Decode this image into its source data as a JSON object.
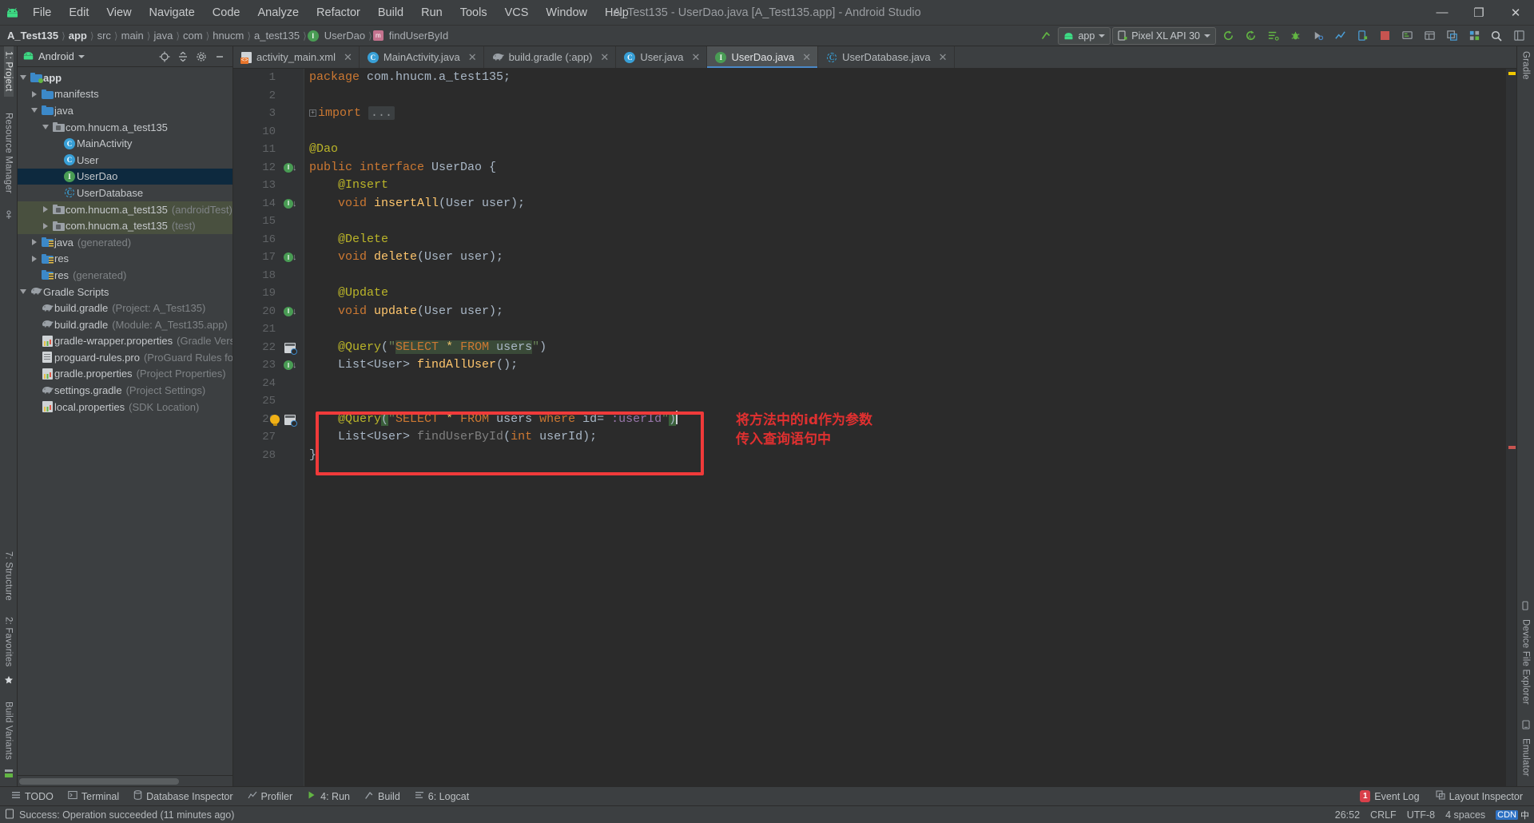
{
  "window": {
    "title": "A_Test135 - UserDao.java [A_Test135.app] - Android Studio",
    "minimize": "—",
    "maximize": "❐",
    "close": "✕"
  },
  "menu": [
    "File",
    "Edit",
    "View",
    "Navigate",
    "Code",
    "Analyze",
    "Refactor",
    "Build",
    "Run",
    "Tools",
    "VCS",
    "Window",
    "Help"
  ],
  "breadcrumb": [
    {
      "label": "A_Test135",
      "bold": true,
      "icon": ""
    },
    {
      "label": "app",
      "bold": true,
      "icon": ""
    },
    {
      "label": "src",
      "bold": false,
      "icon": ""
    },
    {
      "label": "main",
      "bold": false,
      "icon": ""
    },
    {
      "label": "java",
      "bold": false,
      "icon": ""
    },
    {
      "label": "com",
      "bold": false,
      "icon": ""
    },
    {
      "label": "hnucm",
      "bold": false,
      "icon": ""
    },
    {
      "label": "a_test135",
      "bold": false,
      "icon": ""
    },
    {
      "label": "UserDao",
      "bold": false,
      "icon": "interface-icon"
    },
    {
      "label": "findUserById",
      "bold": false,
      "icon": "method-icon"
    }
  ],
  "toolbar": {
    "build_icon": "hammer-icon",
    "run_config": "app",
    "device": "Pixel XL API 30",
    "icons": [
      "sync-gradle-icon",
      "avd-manager-icon",
      "layout-editor-icon",
      "debug-icon",
      "profiler-icon",
      "attach-debugger-icon",
      "stop-icon",
      "device-manager-icon",
      "layout-inspector-icon",
      "sdk-manager-icon",
      "search-everywhere-icon",
      "project-structure-icon"
    ]
  },
  "left_rail": {
    "top": [
      "1: Project"
    ],
    "middle": [
      "Resource Manager"
    ],
    "bottom": [
      "7: Structure",
      "2: Favorites",
      "Build Variants"
    ]
  },
  "right_rail": {
    "items": [
      "Gradle",
      "Device File Explorer",
      "Emulator"
    ]
  },
  "project_panel": {
    "title": "Android",
    "header_icons": [
      "locate-icon",
      "collapse-all-icon",
      "settings-icon",
      "hide-icon"
    ],
    "tree": [
      {
        "depth": 0,
        "twisty": "down",
        "icon": "module-folder-icon",
        "label": "app",
        "bold": true,
        "sub": "",
        "state": "normal"
      },
      {
        "depth": 1,
        "twisty": "right",
        "icon": "folder-icon",
        "label": "manifests",
        "bold": false,
        "sub": "",
        "state": "normal"
      },
      {
        "depth": 1,
        "twisty": "down",
        "icon": "folder-icon",
        "label": "java",
        "bold": false,
        "sub": "",
        "state": "normal"
      },
      {
        "depth": 2,
        "twisty": "down",
        "icon": "package-icon",
        "label": "com.hnucm.a_test135",
        "bold": false,
        "sub": "",
        "state": "normal"
      },
      {
        "depth": 3,
        "twisty": "none",
        "icon": "class-icon",
        "label": "MainActivity",
        "bold": false,
        "sub": "",
        "state": "normal"
      },
      {
        "depth": 3,
        "twisty": "none",
        "icon": "class-icon",
        "label": "User",
        "bold": false,
        "sub": "",
        "state": "normal"
      },
      {
        "depth": 3,
        "twisty": "none",
        "icon": "interface-icon",
        "label": "UserDao",
        "bold": false,
        "sub": "",
        "state": "selected"
      },
      {
        "depth": 3,
        "twisty": "none",
        "icon": "abstract-class-icon",
        "label": "UserDatabase",
        "bold": false,
        "sub": "",
        "state": "normal"
      },
      {
        "depth": 2,
        "twisty": "right",
        "icon": "package-icon",
        "label": "com.hnucm.a_test135",
        "bold": false,
        "sub": "(androidTest)",
        "state": "test"
      },
      {
        "depth": 2,
        "twisty": "right",
        "icon": "package-icon",
        "label": "com.hnucm.a_test135",
        "bold": false,
        "sub": "(test)",
        "state": "test"
      },
      {
        "depth": 1,
        "twisty": "right",
        "icon": "generated-folder-icon",
        "label": "java",
        "bold": false,
        "sub": "(generated)",
        "state": "normal"
      },
      {
        "depth": 1,
        "twisty": "right",
        "icon": "res-folder-icon",
        "label": "res",
        "bold": false,
        "sub": "",
        "state": "normal"
      },
      {
        "depth": 1,
        "twisty": "none",
        "icon": "res-folder-icon",
        "label": "res",
        "bold": false,
        "sub": "(generated)",
        "state": "normal"
      },
      {
        "depth": 0,
        "twisty": "down",
        "icon": "gradle-icon",
        "label": "Gradle Scripts",
        "bold": false,
        "sub": "",
        "state": "normal"
      },
      {
        "depth": 1,
        "twisty": "none",
        "icon": "gradle-icon",
        "label": "build.gradle",
        "bold": false,
        "sub": "(Project: A_Test135)",
        "state": "normal"
      },
      {
        "depth": 1,
        "twisty": "none",
        "icon": "gradle-icon",
        "label": "build.gradle",
        "bold": false,
        "sub": "(Module: A_Test135.app)",
        "state": "normal"
      },
      {
        "depth": 1,
        "twisty": "none",
        "icon": "properties-icon",
        "label": "gradle-wrapper.properties",
        "bold": false,
        "sub": "(Gradle Version)",
        "state": "normal"
      },
      {
        "depth": 1,
        "twisty": "none",
        "icon": "document-icon",
        "label": "proguard-rules.pro",
        "bold": false,
        "sub": "(ProGuard Rules for A_T",
        "state": "normal"
      },
      {
        "depth": 1,
        "twisty": "none",
        "icon": "properties-icon",
        "label": "gradle.properties",
        "bold": false,
        "sub": "(Project Properties)",
        "state": "normal"
      },
      {
        "depth": 1,
        "twisty": "none",
        "icon": "gradle-icon",
        "label": "settings.gradle",
        "bold": false,
        "sub": "(Project Settings)",
        "state": "normal"
      },
      {
        "depth": 1,
        "twisty": "none",
        "icon": "properties-icon",
        "label": "local.properties",
        "bold": false,
        "sub": "(SDK Location)",
        "state": "normal"
      }
    ]
  },
  "tabs": [
    {
      "label": "activity_main.xml",
      "icon": "xml-icon",
      "active": false
    },
    {
      "label": "MainActivity.java",
      "icon": "class-icon",
      "active": false
    },
    {
      "label": "build.gradle (:app)",
      "icon": "gradle-icon",
      "active": false
    },
    {
      "label": "User.java",
      "icon": "class-icon",
      "active": false
    },
    {
      "label": "UserDao.java",
      "icon": "interface-icon",
      "active": true
    },
    {
      "label": "UserDatabase.java",
      "icon": "abstract-class-icon",
      "active": false
    }
  ],
  "editor": {
    "line_numbers": [
      "1",
      "2",
      "3",
      "10",
      "11",
      "12",
      "13",
      "14",
      "15",
      "16",
      "17",
      "18",
      "19",
      "20",
      "21",
      "22",
      "23",
      "24",
      "25",
      "26",
      "27",
      "28"
    ],
    "gutter_markers": [
      {
        "line_index": 5,
        "type": "run-implementations-icon"
      },
      {
        "line_index": 7,
        "type": "run-implementations-icon"
      },
      {
        "line_index": 10,
        "type": "run-implementations-icon"
      },
      {
        "line_index": 13,
        "type": "run-implementations-icon"
      },
      {
        "line_index": 15,
        "type": "database-query-icon"
      },
      {
        "line_index": 16,
        "type": "run-implementations-icon"
      },
      {
        "line_index": 19,
        "type": "database-query-icon"
      },
      {
        "line_index": 19,
        "type": "intention-bulb-icon"
      }
    ],
    "code_lines": [
      "package com.hnucm.a_test135;",
      "",
      "import ...",
      "",
      "@Dao",
      "public interface UserDao {",
      "    @Insert",
      "    void insertAll(User user);",
      "",
      "    @Delete",
      "    void delete(User user);",
      "",
      "    @Update",
      "    void update(User user);",
      "",
      "    @Query(\"SELECT * FROM users\")",
      "    List<User> findAllUser();",
      "",
      "",
      "    @Query(\"SELECT * FROM users where id= :userId\")",
      "    List<User> findUserById(int userId);",
      "}"
    ],
    "annotation": {
      "line1": "将方法中的id作为参数",
      "line2": "传入查询语句中",
      "color": "#e03030"
    },
    "highlight_box_color": "#f03a3a"
  },
  "tool_window_bar": {
    "left": [
      {
        "label": "TODO",
        "icon": "todo-icon"
      },
      {
        "label": "Terminal",
        "icon": "terminal-icon"
      },
      {
        "label": "Database Inspector",
        "icon": "database-icon"
      },
      {
        "label": "Profiler",
        "icon": "profiler-icon"
      },
      {
        "label": "4: Run",
        "icon": "run-icon"
      },
      {
        "label": "Build",
        "icon": "build-icon"
      },
      {
        "label": "6: Logcat",
        "icon": "logcat-icon"
      }
    ],
    "right": [
      {
        "label": "Event Log",
        "icon": "event-log-icon",
        "badge": "1"
      },
      {
        "label": "Layout Inspector",
        "icon": "layout-inspector-icon",
        "badge": ""
      }
    ]
  },
  "status_bar": {
    "icon": "notification-icon",
    "message": "Success: Operation succeeded (11 minutes ago)",
    "caret_position": "26:52",
    "line_separator": "CRLF",
    "encoding": "UTF-8",
    "indent": "4 spaces",
    "ime": "中",
    "ime_label": "CDN"
  }
}
